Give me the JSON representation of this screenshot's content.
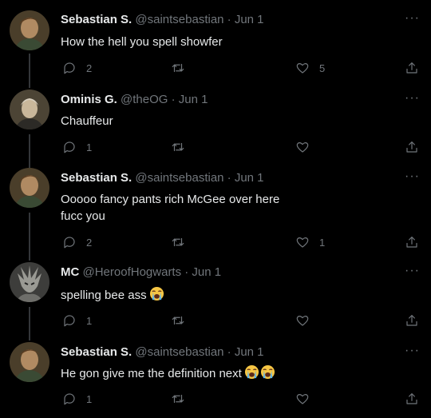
{
  "tweets": [
    {
      "name": "Sebastian S.",
      "meta": "@saintsebastian · Jun 1",
      "lines": [
        "How the hell you spell showfer"
      ],
      "emoji_count": 0,
      "reply_count": "2",
      "retweet_count": "",
      "like_count": "5"
    },
    {
      "name": "Ominis G.",
      "meta": "@theOG · Jun 1",
      "lines": [
        "Chauffeur"
      ],
      "emoji_count": 0,
      "reply_count": "1",
      "retweet_count": "",
      "like_count": ""
    },
    {
      "name": "Sebastian S.",
      "meta": "@saintsebastian · Jun 1",
      "lines": [
        "Ooooo fancy pants rich McGee over here",
        "fucc you"
      ],
      "emoji_count": 0,
      "reply_count": "2",
      "retweet_count": "",
      "like_count": "1"
    },
    {
      "name": "MC",
      "meta": "@HeroofHogwarts · Jun 1",
      "lines": [
        "spelling bee ass"
      ],
      "emoji_count": 1,
      "reply_count": "1",
      "retweet_count": "",
      "like_count": ""
    },
    {
      "name": "Sebastian S.",
      "meta": "@saintsebastian · Jun 1",
      "lines": [
        "He gon give me the definition next"
      ],
      "emoji_count": 2,
      "reply_count": "1",
      "retweet_count": "",
      "like_count": ""
    }
  ],
  "icons": {
    "more": "more-icon",
    "reply": "reply-icon",
    "retweet": "retweet-icon",
    "like": "heart-icon",
    "share": "share-icon",
    "emoji": "loudly-crying-face-emoji"
  },
  "colors": {
    "background": "#000000",
    "text": "#e7e9ea",
    "secondary": "#71767b",
    "thread_line": "#333639"
  }
}
